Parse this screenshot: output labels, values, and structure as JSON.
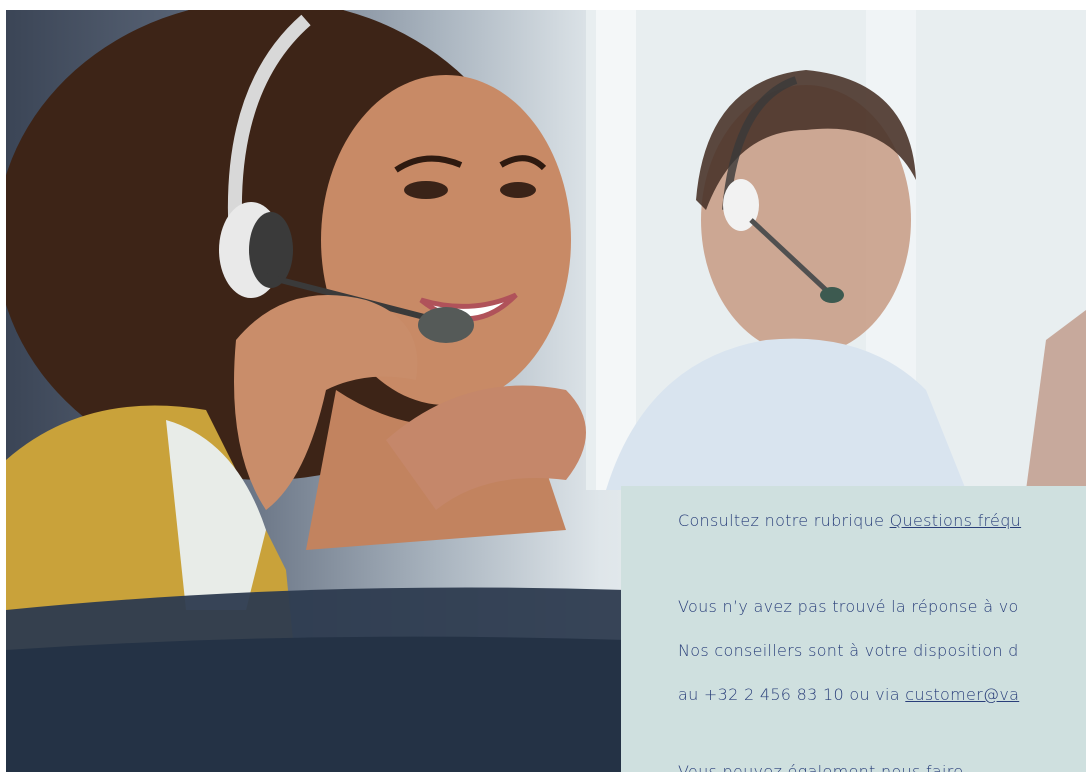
{
  "card": {
    "line1_prefix": "Consultez notre rubrique ",
    "faq_link": "Questions fréqu",
    "line2": "Vous n’y avez pas trouvé la réponse à vo",
    "line3": "Nos conseillers sont à votre disposition d",
    "line4_prefix": "au +32 2 456 83 10 ou via ",
    "email_link": "customer@va",
    "line5": "Vous pouvez également nous faire"
  },
  "colors": {
    "card_background": "#cfe0df",
    "text": "#2a3f7a"
  }
}
